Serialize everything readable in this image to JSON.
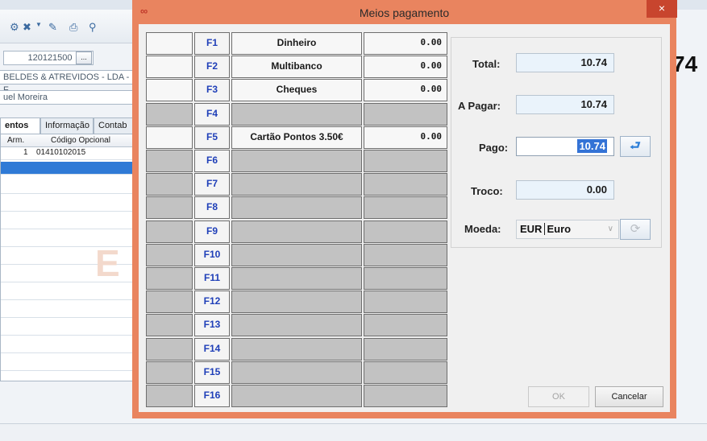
{
  "background_app": {
    "customer_code": "120121500",
    "customer_name": "BELDES & ATREVIDOS - LDA - F",
    "contact": "uel Moreira",
    "tabs": [
      {
        "label": "entos"
      },
      {
        "label": "Informação"
      },
      {
        "label": "Contab"
      }
    ],
    "grid_headers": [
      "Arm.",
      "Código Opcional"
    ],
    "grid_row": {
      "arm": "1",
      "codigo": "01410102015"
    },
    "total_fragment": "74",
    "watermark": "E"
  },
  "dialog": {
    "title": "Meios pagamento",
    "close_label": "×"
  },
  "payments": [
    {
      "key": "F1",
      "name": "Dinheiro",
      "amount": "0.00",
      "enabled": true
    },
    {
      "key": "F2",
      "name": "Multibanco",
      "amount": "0.00",
      "enabled": true
    },
    {
      "key": "F3",
      "name": "Cheques",
      "amount": "0.00",
      "enabled": true
    },
    {
      "key": "F4",
      "name": "",
      "amount": "",
      "enabled": false
    },
    {
      "key": "F5",
      "name": "Cartão Pontos 3.50€",
      "amount": "0.00",
      "enabled": true
    },
    {
      "key": "F6",
      "name": "",
      "amount": "",
      "enabled": false
    },
    {
      "key": "F7",
      "name": "",
      "amount": "",
      "enabled": false
    },
    {
      "key": "F8",
      "name": "",
      "amount": "",
      "enabled": false
    },
    {
      "key": "F9",
      "name": "",
      "amount": "",
      "enabled": false
    },
    {
      "key": "F10",
      "name": "",
      "amount": "",
      "enabled": false
    },
    {
      "key": "F11",
      "name": "",
      "amount": "",
      "enabled": false
    },
    {
      "key": "F12",
      "name": "",
      "amount": "",
      "enabled": false
    },
    {
      "key": "F13",
      "name": "",
      "amount": "",
      "enabled": false
    },
    {
      "key": "F14",
      "name": "",
      "amount": "",
      "enabled": false
    },
    {
      "key": "F15",
      "name": "",
      "amount": "",
      "enabled": false
    },
    {
      "key": "F16",
      "name": "",
      "amount": "",
      "enabled": false
    }
  ],
  "summary": {
    "total_label": "Total:",
    "total_value": "10.74",
    "apagar_label": "A Pagar:",
    "apagar_value": "10.74",
    "pago_label": "Pago:",
    "pago_value": "10.74",
    "troco_label": "Troco:",
    "troco_value": "0.00",
    "moeda_label": "Moeda:",
    "currency_code": "EUR",
    "currency_name": "Euro"
  },
  "buttons": {
    "ok": "OK",
    "cancel": "Cancelar"
  },
  "colors": {
    "dialog_frame": "#e9845f",
    "close_button": "#c8452e",
    "key_text": "#1f3fb8",
    "selection": "#3473d6"
  }
}
